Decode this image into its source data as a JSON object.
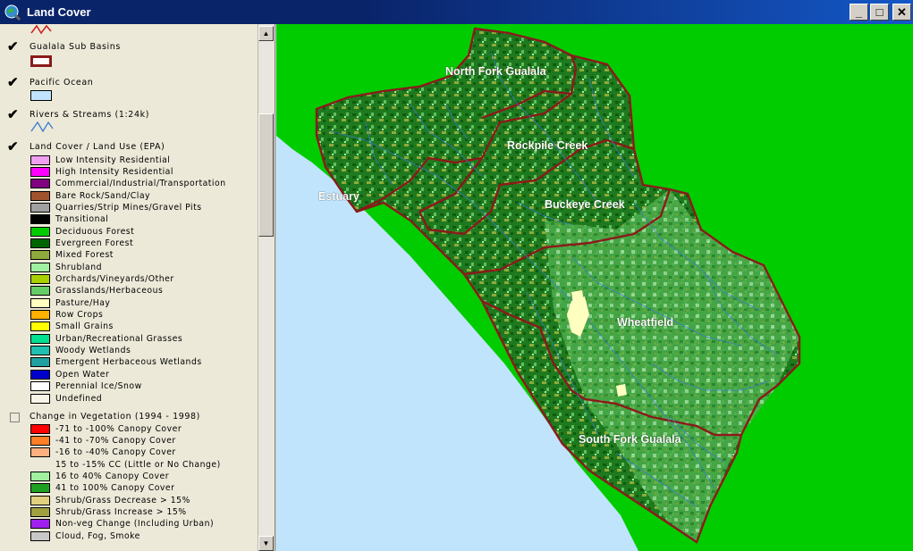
{
  "window": {
    "title": "Land Cover",
    "minimize": "_",
    "maximize": "□",
    "close": "✕"
  },
  "toc": {
    "layers": [
      {
        "title": "Gualala Sub Basins",
        "checked": true
      },
      {
        "title": "Pacific Ocean",
        "checked": true
      },
      {
        "title": "Rivers & Streams (1:24k)",
        "checked": true
      },
      {
        "title": "Land Cover / Land Use (EPA)",
        "checked": true
      },
      {
        "title": "Change in Vegetation (1994 - 1998)",
        "checked": false
      }
    ],
    "land_cover_legend": [
      {
        "label": "Low Intensity Residential",
        "color": "#f0a0f0"
      },
      {
        "label": "High Intensity Residential",
        "color": "#ff00ff"
      },
      {
        "label": "Commercial/Industrial/Transportation",
        "color": "#800080"
      },
      {
        "label": "Bare Rock/Sand/Clay",
        "color": "#a0522d"
      },
      {
        "label": "Quarries/Strip Mines/Gravel Pits",
        "color": "#a0a0a0"
      },
      {
        "label": "Transitional",
        "color": "#000000"
      },
      {
        "label": "Deciduous Forest",
        "color": "#00cc00"
      },
      {
        "label": "Evergreen Forest",
        "color": "#006400"
      },
      {
        "label": "Mixed Forest",
        "color": "#8faa3c"
      },
      {
        "label": "Shrubland",
        "color": "#a0f0a0"
      },
      {
        "label": "Orchards/Vineyards/Other",
        "color": "#a8d000"
      },
      {
        "label": "Grasslands/Herbaceous",
        "color": "#66cc66"
      },
      {
        "label": "Pasture/Hay",
        "color": "#ffffc0"
      },
      {
        "label": "Row Crops",
        "color": "#ffb000"
      },
      {
        "label": "Small Grains",
        "color": "#ffff00"
      },
      {
        "label": "Urban/Recreational Grasses",
        "color": "#00e090"
      },
      {
        "label": "Woody Wetlands",
        "color": "#20c0b0"
      },
      {
        "label": "Emergent Herbaceous Wetlands",
        "color": "#20a0a0"
      },
      {
        "label": "Open Water",
        "color": "#0000cc"
      },
      {
        "label": "Perennial Ice/Snow",
        "color": "#ffffff"
      },
      {
        "label": "Undefined",
        "color": "#f8f4e8"
      }
    ],
    "change_legend": [
      {
        "label": "-71 to -100% Canopy Cover",
        "color": "#ff0000"
      },
      {
        "label": "-41 to -70% Canopy Cover",
        "color": "#ff7f27"
      },
      {
        "label": "-16 to -40% Canopy Cover",
        "color": "#ffb080"
      },
      {
        "label": "15 to -15% CC (Little or No Change)",
        "color": ""
      },
      {
        "label": "16 to 40% Canopy Cover",
        "color": "#a0f0a0"
      },
      {
        "label": "41 to 100% Canopy Cover",
        "color": "#20a020"
      },
      {
        "label": "Shrub/Grass Decrease > 15%",
        "color": "#e0d080"
      },
      {
        "label": "Shrub/Grass Increase > 15%",
        "color": "#a0a040"
      },
      {
        "label": "Non-veg Change (Including Urban)",
        "color": "#a020f0"
      },
      {
        "label": "Cloud, Fog, Smoke",
        "color": "#c8c8c8"
      }
    ],
    "layer_symbols": {
      "sub_basins_color": "#8b1a1a",
      "ocean_color": "#bfe4fb",
      "stream_color": "#3a7bd5"
    }
  },
  "map": {
    "labels": [
      "North Fork Gualala",
      "Rockpile Creek",
      "Estuary",
      "Buckeye Creek",
      "Wheatfield",
      "South Fork Gualala"
    ],
    "colors": {
      "land": "#00cc00",
      "ocean": "#bfe4fb",
      "forest": "#006400",
      "boundary": "#8b1a1a"
    }
  }
}
